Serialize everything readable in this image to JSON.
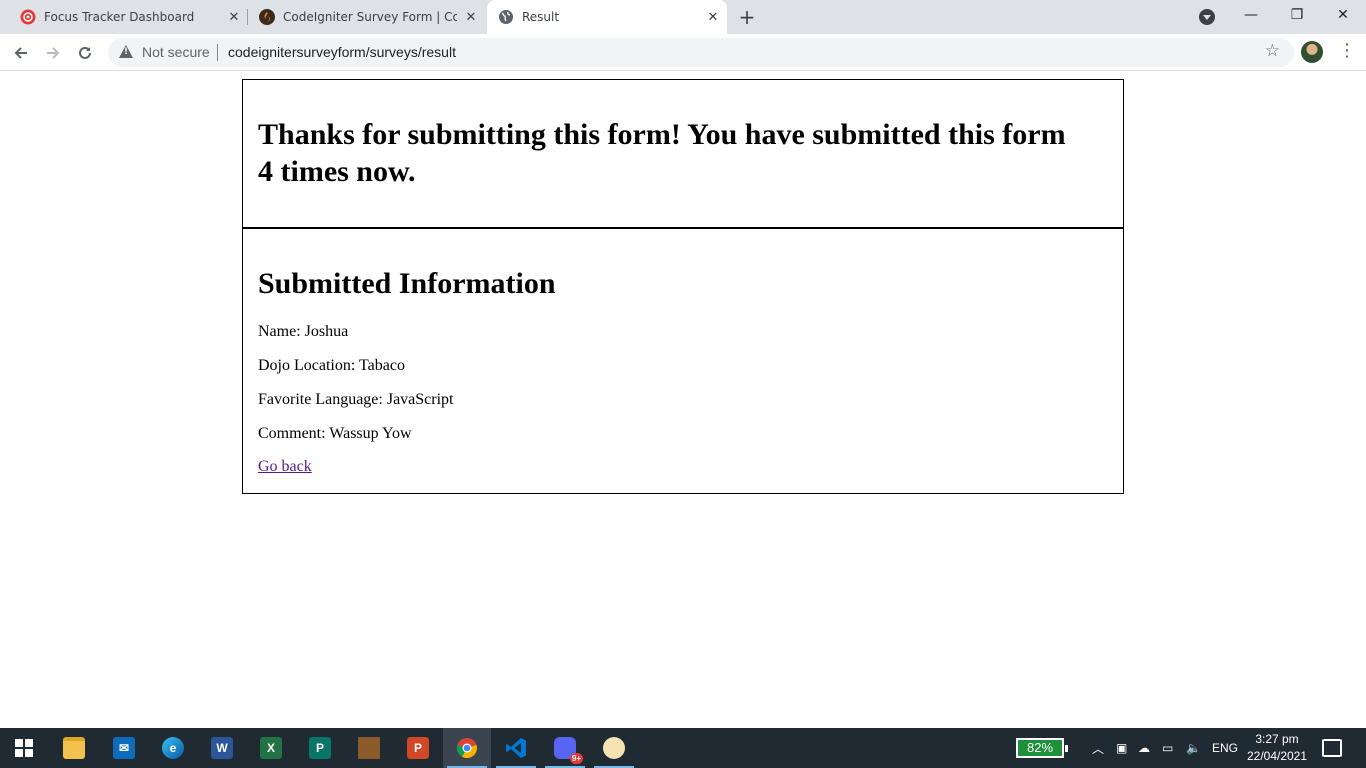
{
  "browser": {
    "tabs": [
      {
        "title": "Focus Tracker Dashboard",
        "favicon": "focus-tracker-icon",
        "active": false
      },
      {
        "title": "CodeIgniter Survey Form | CodeIgniter",
        "favicon": "codeigniter-icon",
        "active": false
      },
      {
        "title": "Result",
        "favicon": "globe-icon",
        "active": true
      }
    ],
    "security_label": "Not secure",
    "url": "codeignitersurveyform/surveys/result"
  },
  "page": {
    "heading": "Thanks for submitting this form! You have submitted this form 4 times now.",
    "section_title": "Submitted Information",
    "fields": [
      "Name: Joshua",
      "Dojo Location: Tabaco",
      "Favorite Language: JavaScript",
      "Comment: Wassup Yow"
    ],
    "back_link": "Go back"
  },
  "taskbar": {
    "apps": [
      "start-button",
      "file-explorer-icon",
      "mail-icon",
      "edge-icon",
      "word-icon",
      "excel-icon",
      "publisher-icon",
      "bible-app-icon",
      "powerpoint-icon",
      "chrome-icon",
      "vscode-icon",
      "discord-icon",
      "paint-icon"
    ],
    "discord_badge": "9+",
    "battery": "82%",
    "language": "ENG",
    "time": "3:27 pm",
    "date": "22/04/2021"
  },
  "colors": {
    "tabstrip": "#dee1e6",
    "taskbar": "#1f2a33",
    "battery": "#1e8f3a",
    "link_visited": "#551a8b"
  }
}
